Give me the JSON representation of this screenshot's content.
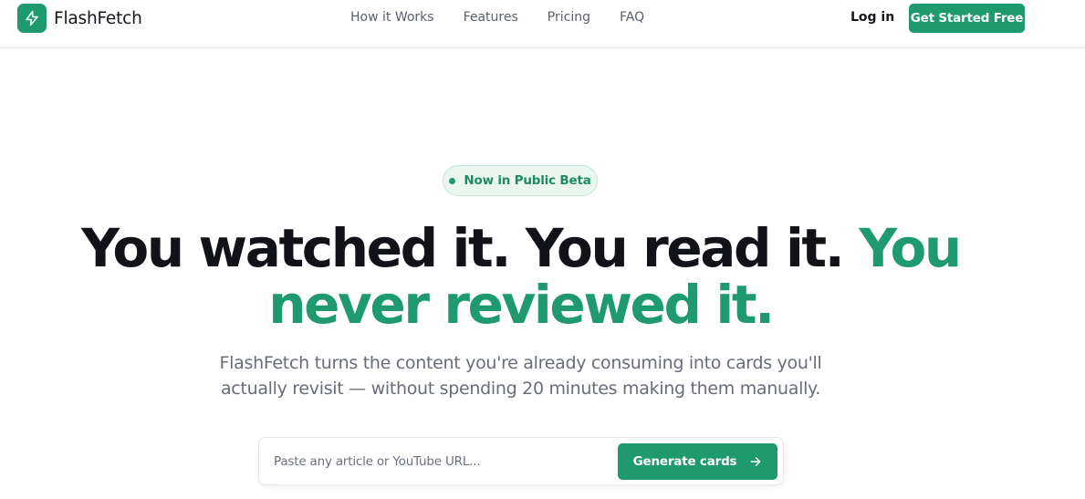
{
  "brand": {
    "name": "FlashFetch",
    "icon": "lightning-bolt-icon"
  },
  "nav": {
    "items": [
      {
        "label": "How it Works"
      },
      {
        "label": "Features"
      },
      {
        "label": "Pricing"
      },
      {
        "label": "FAQ"
      }
    ],
    "login_label": "Log in",
    "cta_label": "Get Started Free"
  },
  "hero": {
    "badge": "Now in Public Beta",
    "headline_dark": "You watched it. You read it.",
    "headline_accent": "You never reviewed it.",
    "subheadline_line1": "FlashFetch turns the content you're already consuming into cards you'll",
    "subheadline_line2": "actually revisit — without spending 20 minutes making them manually."
  },
  "url_form": {
    "placeholder": "Paste any article or YouTube URL...",
    "value": "",
    "button_label": "Generate cards",
    "button_icon": "arrow-right-icon"
  },
  "colors": {
    "accent": "#1f9a6e",
    "text": "#111318",
    "muted": "#686d77"
  }
}
